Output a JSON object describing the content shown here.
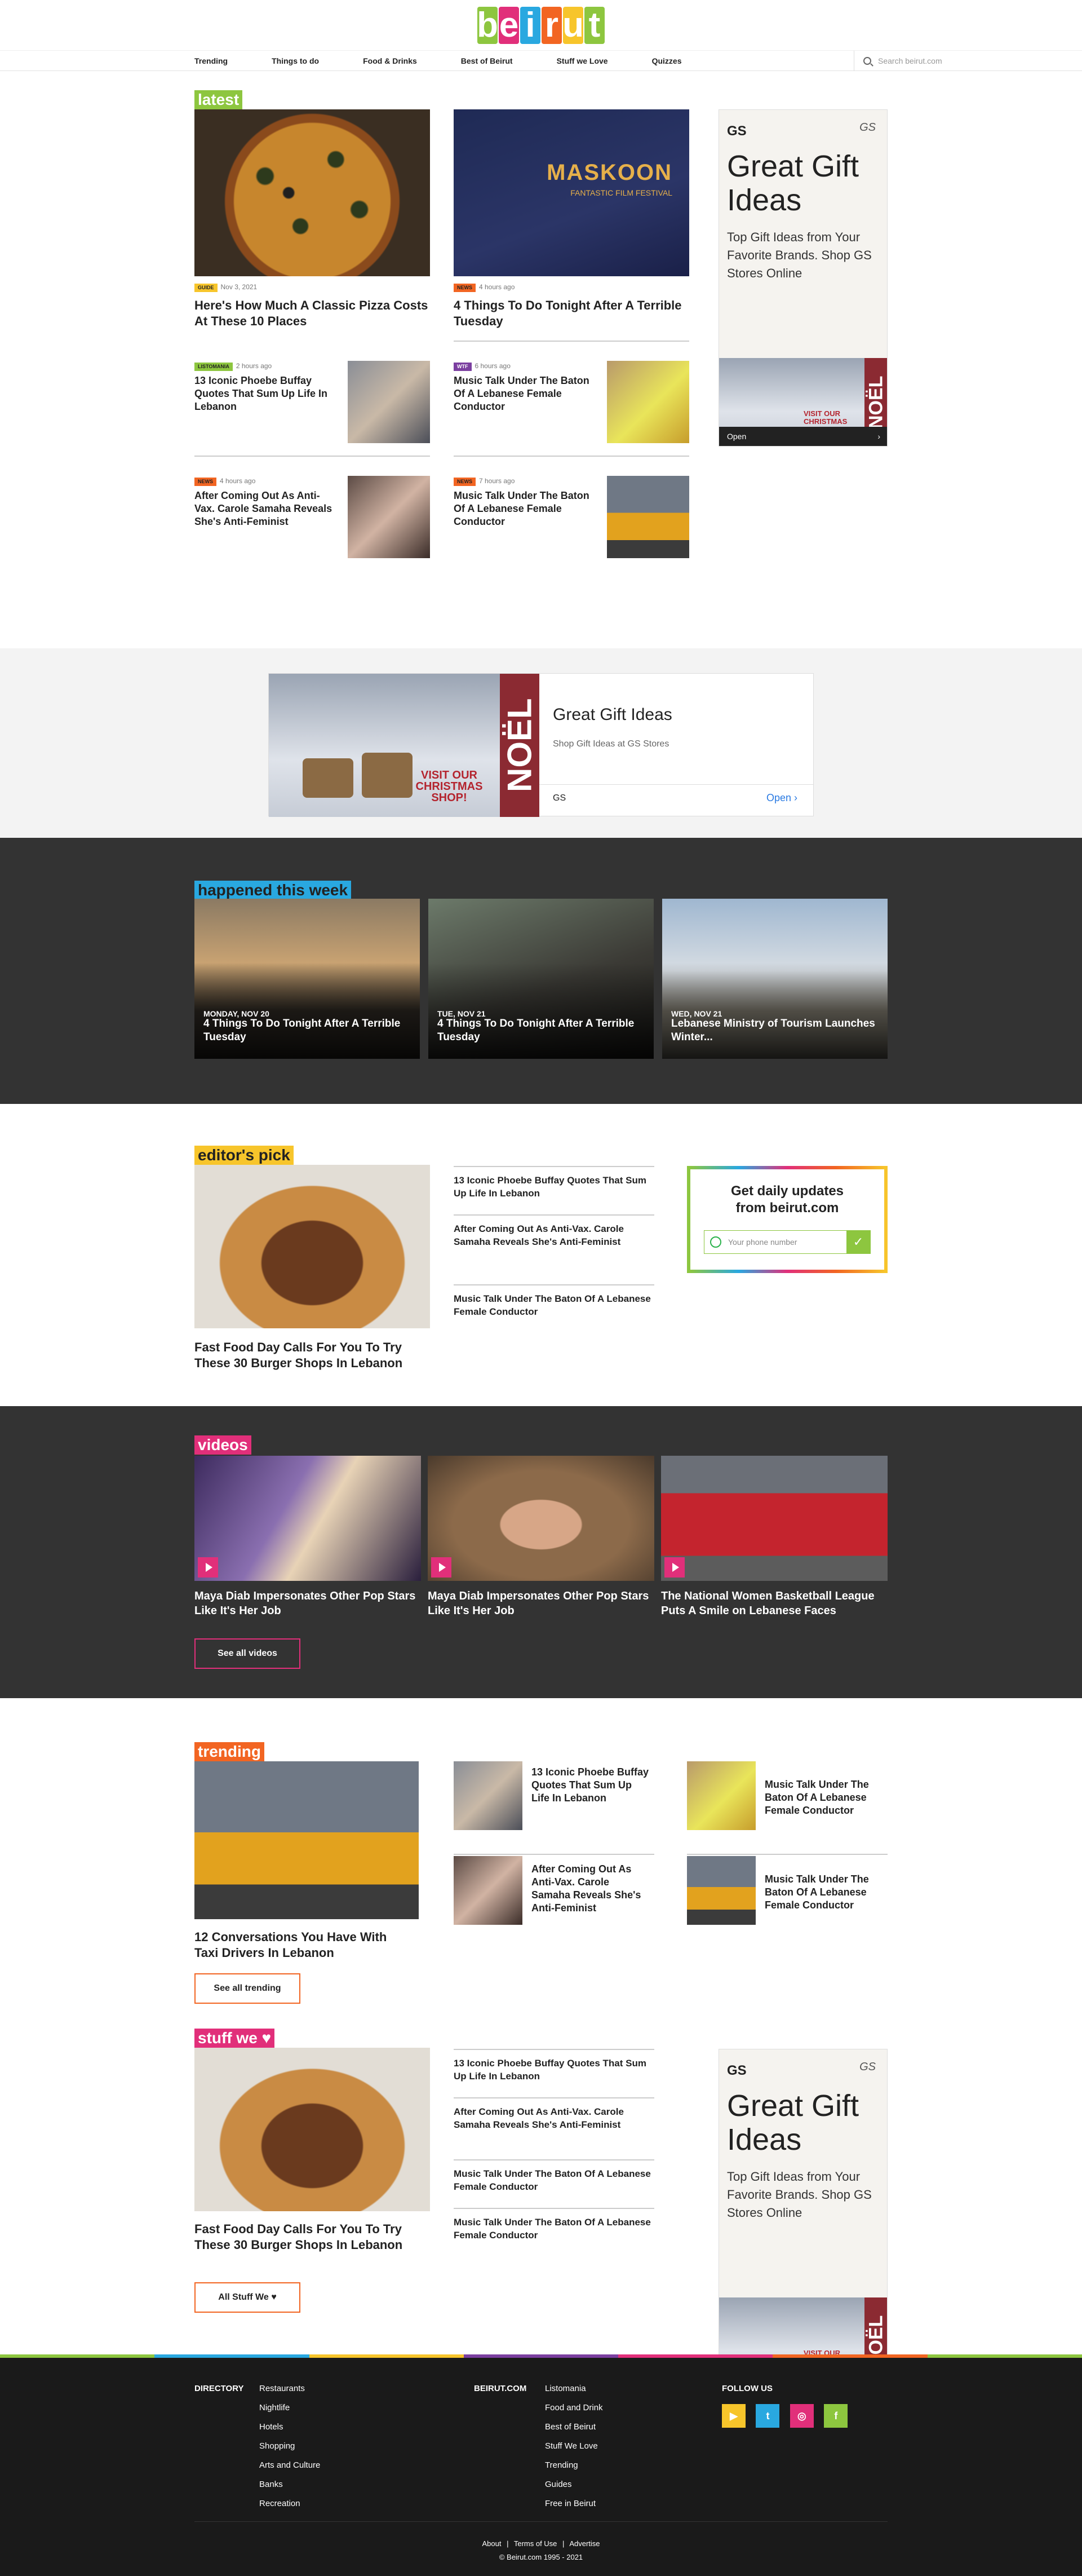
{
  "logo": {
    "letters": [
      "b",
      "e",
      "i",
      "r",
      "u",
      "t"
    ],
    "colors": [
      "#8dc63f",
      "#e12f7a",
      "#29a8e0",
      "#f26522",
      "#f7c52b",
      "#8dc63f"
    ]
  },
  "nav": {
    "items": [
      "Trending",
      "Things to do",
      "Food & Drinks",
      "Best of Beirut",
      "Stuff we Love",
      "Quizzes"
    ],
    "search_placeholder": "Search beirut.com"
  },
  "colors": {
    "green": "#8dc63f",
    "blue": "#29a8e0",
    "yellow": "#f7c52b",
    "pink": "#e12f7a",
    "orange": "#f26522",
    "purple": "#7b3fa0"
  },
  "latest": {
    "label": "latest",
    "main": [
      {
        "tag": "GUIDE",
        "time": "Nov 3, 2021",
        "title": "Here's How Much A Classic Pizza Costs At These 10 Places"
      },
      {
        "tag": "NEWS",
        "time": "4 hours ago",
        "title": "4 Things To Do Tonight After A Terrible Tuesday",
        "poster": "MASKOON",
        "poster_sub": "FANTASTIC FILM FESTIVAL"
      }
    ],
    "small": [
      {
        "tag": "LISTOMANIA",
        "time": "2 hours ago",
        "title": "13 Iconic Phoebe Buffay Quotes That Sum Up Life In Lebanon"
      },
      {
        "tag": "WTF",
        "time": "6 hours ago",
        "title": "Music Talk Under The Baton Of A Lebanese Female Conductor"
      },
      {
        "tag": "NEWS",
        "time": "4 hours ago",
        "title": "After Coming Out As Anti-Vax. Carole Samaha Reveals She's Anti-Feminist"
      },
      {
        "tag": "NEWS",
        "time": "7 hours ago",
        "title": "Music Talk Under The Baton Of A Lebanese Female Conductor"
      }
    ]
  },
  "ad_side": {
    "brand": "GS",
    "title": "Great Gift Ideas",
    "body": "Top Gift Ideas from Your Favorite Brands. Shop GS Stores Online",
    "cta": "Open",
    "noel": "NOËL",
    "banner_text": "VISIT OUR CHRISTMAS SHOP!"
  },
  "ad_wide": {
    "title": "Great Gift Ideas",
    "sub": "Shop Gift Ideas at GS Stores",
    "brand": "GS",
    "cta": "Open",
    "noel": "NOËL",
    "banner_text": "VISIT OUR CHRISTMAS SHOP!"
  },
  "week": {
    "label": "happened this week",
    "items": [
      {
        "date": "MONDAY, NOV 20",
        "title": "4 Things To Do Tonight After A Terrible Tuesday"
      },
      {
        "date": "TUE, NOV 21",
        "title": "4 Things To Do Tonight After A Terrible Tuesday"
      },
      {
        "date": "WED, NOV 21",
        "title": "Lebanese Ministry of Tourism Launches Winter..."
      }
    ]
  },
  "editors": {
    "label": "editor's pick",
    "main_title": "Fast Food Day Calls For You To Try These 30 Burger Shops In Lebanon",
    "list": [
      "13 Iconic Phoebe Buffay Quotes That Sum Up Life In Lebanon",
      "After Coming Out As Anti-Vax. Carole Samaha Reveals She's Anti-Feminist",
      "Music Talk Under The Baton Of A Lebanese Female Conductor"
    ],
    "signup_title": "Get daily updates from beirut.com",
    "signup_placeholder": "Your phone number"
  },
  "videos": {
    "label": "videos",
    "items": [
      "Maya Diab Impersonates Other Pop Stars Like It's Her Job",
      "Maya Diab Impersonates Other Pop Stars Like It's Her Job",
      "The National Women Basketball League Puts A Smile on Lebanese Faces"
    ],
    "button": "See all videos"
  },
  "trending": {
    "label": "trending",
    "main_title": "12 Conversations You Have With Taxi Drivers In Lebanon",
    "items": [
      "13 Iconic Phoebe Buffay Quotes That Sum Up Life In Lebanon",
      "Music Talk Under The Baton Of A Lebanese Female Conductor",
      "After Coming Out As Anti-Vax. Carole Samaha Reveals She's Anti-Feminist",
      "Music Talk Under The Baton Of A Lebanese Female Conductor"
    ],
    "button": "See all trending"
  },
  "stuff": {
    "label": "stuff we ♥",
    "main_title": "Fast Food Day Calls For You To Try These 30 Burger Shops In Lebanon",
    "list": [
      "13 Iconic Phoebe Buffay Quotes That Sum Up Life In Lebanon",
      "After Coming Out As Anti-Vax. Carole Samaha Reveals She's Anti-Feminist",
      "Music Talk Under The Baton Of A Lebanese Female Conductor",
      "Music Talk Under The Baton Of A Lebanese Female Conductor"
    ],
    "button": "All Stuff We ♥"
  },
  "footer": {
    "directory_head": "DIRECTORY",
    "directory": [
      "Restaurants",
      "Nightlife",
      "Hotels",
      "Shopping",
      "Arts and Culture",
      "Banks",
      "Recreation"
    ],
    "beirut_head": "BEIRUT.COM",
    "beirut": [
      "Listomania",
      "Food and Drink",
      "Best of Beirut",
      "Stuff We Love",
      "Trending",
      "Guides",
      "Free in Beirut"
    ],
    "follow_head": "FOLLOW US",
    "links": [
      "About",
      "Terms of Use",
      "Advertise"
    ],
    "copyright": "© Beirut.com 1995 - 2021"
  }
}
